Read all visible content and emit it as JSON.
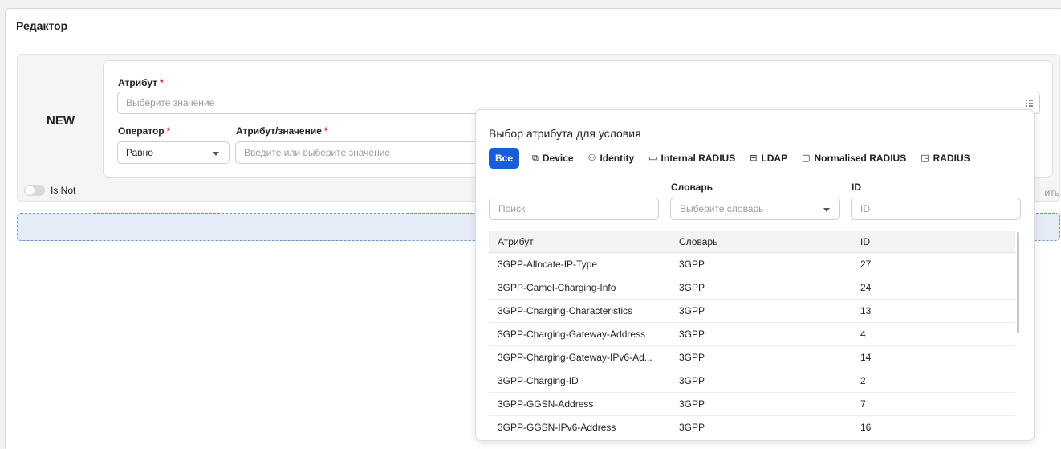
{
  "editor": {
    "title": "Редактор"
  },
  "condition": {
    "badge": "NEW",
    "attribute_label": "Атрибут",
    "required_mark": "*",
    "attribute_placeholder": "Выберите значение",
    "operator_label": "Оператор",
    "operator_value": "Равно",
    "value_label": "Атрибут/значение",
    "value_placeholder": "Введите или выберите значение",
    "is_not_label": "Is Not",
    "truncated_text": "ить"
  },
  "popover": {
    "title": "Выбор атрибута для условия",
    "tabs": [
      {
        "label": "Все",
        "icon": "",
        "active": true
      },
      {
        "label": "Device",
        "icon": "device-icon"
      },
      {
        "label": "Identity",
        "icon": "users-icon"
      },
      {
        "label": "Internal RADIUS",
        "icon": "laptop-icon"
      },
      {
        "label": "LDAP",
        "icon": "folder-icon"
      },
      {
        "label": "Normalised RADIUS",
        "icon": "monitor-icon"
      },
      {
        "label": "RADIUS",
        "icon": "cast-icon"
      }
    ],
    "filters": {
      "search_placeholder": "Поиск",
      "dictionary_label": "Словарь",
      "dictionary_placeholder": "Выберите словарь",
      "id_label": "ID",
      "id_placeholder": "ID"
    },
    "table": {
      "columns": [
        "Атрибут",
        "Словарь",
        "ID"
      ],
      "rows": [
        [
          "3GPP-Allocate-IP-Type",
          "3GPP",
          "27"
        ],
        [
          "3GPP-Camel-Charging-Info",
          "3GPP",
          "24"
        ],
        [
          "3GPP-Charging-Characteristics",
          "3GPP",
          "13"
        ],
        [
          "3GPP-Charging-Gateway-Address",
          "3GPP",
          "4"
        ],
        [
          "3GPP-Charging-Gateway-IPv6-Ad...",
          "3GPP",
          "14"
        ],
        [
          "3GPP-Charging-ID",
          "3GPP",
          "2"
        ],
        [
          "3GPP-GGSN-Address",
          "3GPP",
          "7"
        ],
        [
          "3GPP-GGSN-IPv6-Address",
          "3GPP",
          "16"
        ]
      ]
    }
  },
  "colors": {
    "accent": "#1a5ed6",
    "required": "#d32f2f",
    "dropzone": "#e6ecf7"
  }
}
